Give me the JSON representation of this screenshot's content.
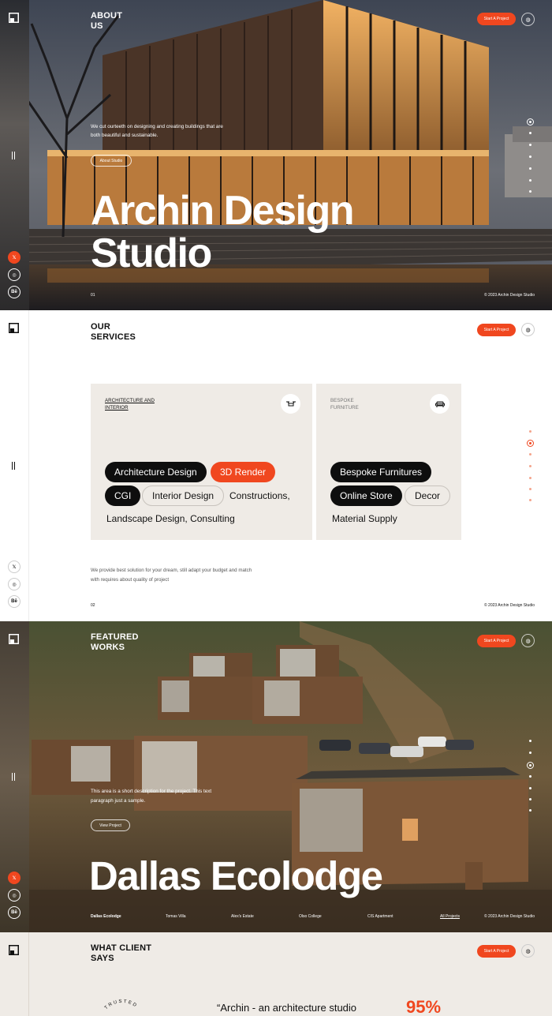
{
  "brand": {
    "accent": "#f0471f"
  },
  "hero": {
    "section_title": "ABOUT\nUS",
    "cta": "Start A Project",
    "description": "We cut ourteeth on designing and creating buildings that are both beautiful and sustainable.",
    "about_button": "About Studio",
    "title_line1": "Archin Design",
    "title_line2": "Studio",
    "slide_number": "01",
    "copyright": "© 2023 Archin Design Studio"
  },
  "sidebar": {
    "socials": [
      {
        "icon": "x-twitter-icon",
        "glyph": "𝕏"
      },
      {
        "icon": "instagram-icon",
        "glyph": "◎"
      },
      {
        "icon": "behance-icon",
        "glyph": "Bē"
      }
    ]
  },
  "services": {
    "section_title": "OUR\nSERVICES",
    "cta": "Start A Project",
    "card1": {
      "label": "ARCHITECTURE AND\nINTERIOR",
      "icon": "drone-icon",
      "tags": [
        "Architecture Design",
        "3D Render",
        "CGI",
        "Interior Design",
        "Constructions,",
        "Landscape Design, Consulting"
      ]
    },
    "card2": {
      "label": "BESPOKE\nFURNITURE",
      "icon": "sofa-icon",
      "tags": [
        "Bespoke Furnitures",
        "Online Store",
        "Decor",
        "Material Supply"
      ]
    },
    "description": "We provide best solution for your dream, still adapt your budget and match with requires about quality of project",
    "slide_number": "02",
    "copyright": "© 2023 Archin Design Studio"
  },
  "featured": {
    "section_title": "FEATURED\nWORKS",
    "cta": "Start A Project",
    "description": "This area is a short description for the project. This text paragraph just a sample.",
    "view_button": "View Project",
    "title": "Dallas Ecolodge",
    "projects": [
      "Dallas Ecolodge",
      "Tomas Villa",
      "Alex's Estate",
      "Olso College",
      "CIS Apartment"
    ],
    "all_projects": "All Projects",
    "copyright": "© 2023 Archin Design Studio"
  },
  "clients": {
    "section_title": "WHAT CLIENT\nSAYS",
    "cta": "Start A Project",
    "badge_text": "TRUSTED",
    "quote": "“Archin - an architecture studio",
    "stat": "95%"
  }
}
